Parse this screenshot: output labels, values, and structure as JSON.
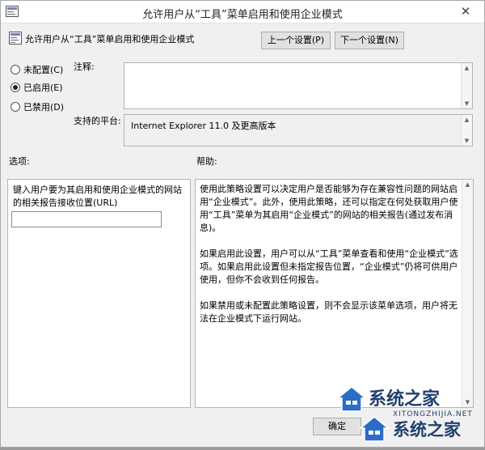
{
  "window": {
    "title": "允许用户从“工具”菜单启用和使用企业模式"
  },
  "header": {
    "setting_name": "允许用户从“工具”菜单启用和使用企业模式",
    "prev_button": "上一个设置(P)",
    "next_button": "下一个设置(N)"
  },
  "state_options": [
    {
      "label": "未配置(C)",
      "selected": false
    },
    {
      "label": "已启用(E)",
      "selected": true
    },
    {
      "label": "已禁用(D)",
      "selected": false
    }
  ],
  "comment": {
    "label": "注释:",
    "value": ""
  },
  "platform": {
    "label": "支持的平台:",
    "value": "Internet Explorer 11.0 及更高版本"
  },
  "options": {
    "label": "选项:",
    "field_label": "键入用户要为其启用和使用企业模式的网站的相关报告接收位置(URL)",
    "field_value": ""
  },
  "help": {
    "label": "帮助:",
    "paragraphs": [
      "使用此策略设置可以决定用户是否能够为存在兼容性问题的网站启用“企业模式”。此外，使用此策略，还可以指定在何处获取用户使用“工具”菜单为其启用“企业模式”的网站的相关报告(通过发布消息)。",
      "如果启用此设置，用户可以从“工具”菜单查看和使用“企业模式”选项。如果启用此设置但未指定报告位置，“企业模式”仍将可供用户使用，但你不会收到任何报告。",
      "如果禁用或未配置此策略设置，则不会显示该菜单选项，用户将无法在企业模式下运行网站。"
    ]
  },
  "footer": {
    "ok_button": "确定"
  },
  "watermark": {
    "text1": "系统之家",
    "text2": "系统之家",
    "url": "XITONGZHIJIA.NET"
  },
  "colors": {
    "window_bg": "#f0f0f0",
    "watermark": "#1f3f6f"
  }
}
